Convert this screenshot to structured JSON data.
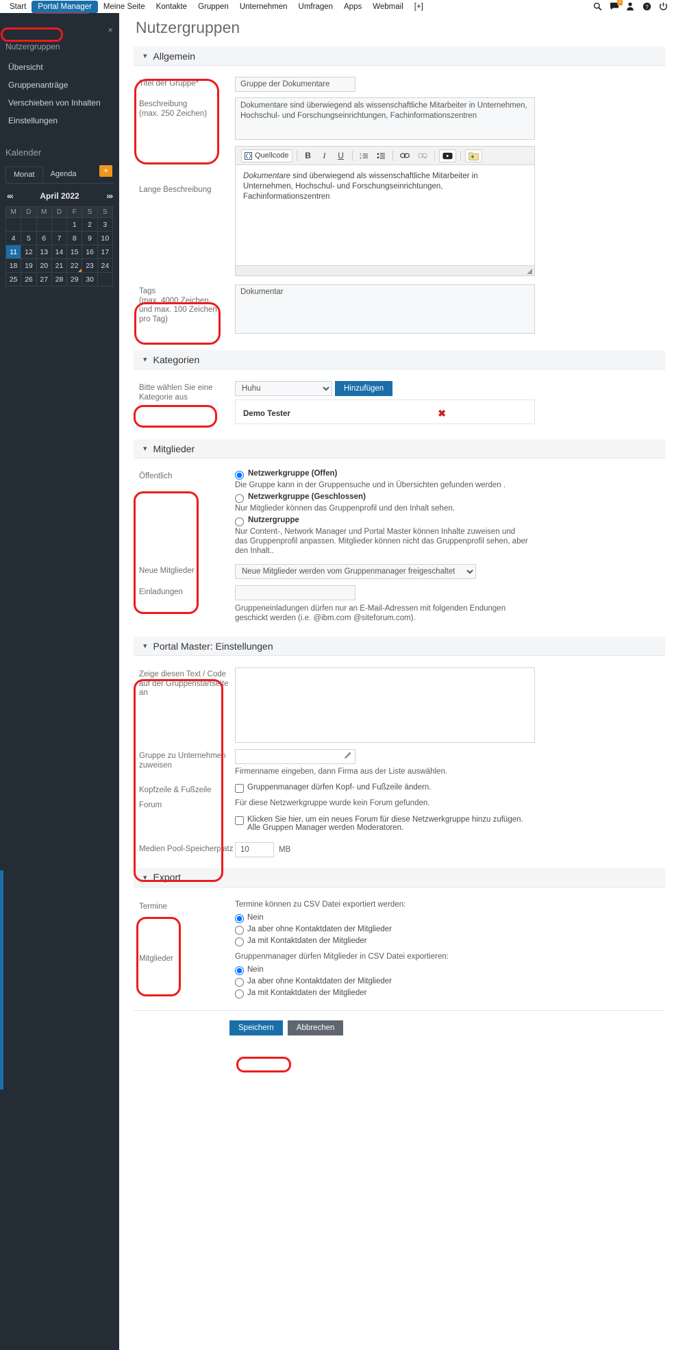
{
  "topnav": {
    "items": [
      {
        "label": "Start",
        "active": false
      },
      {
        "label": "Portal Manager",
        "active": true
      },
      {
        "label": "Meine Seite",
        "active": false
      },
      {
        "label": "Kontakte",
        "active": false
      },
      {
        "label": "Gruppen",
        "active": false
      },
      {
        "label": "Unternehmen",
        "active": false
      },
      {
        "label": "Umfragen",
        "active": false
      },
      {
        "label": "Apps",
        "active": false
      },
      {
        "label": "Webmail",
        "active": false
      },
      {
        "label": "[+]",
        "active": false
      }
    ],
    "icons": [
      "search-icon",
      "messages-icon",
      "user-icon",
      "help-icon",
      "power-icon"
    ],
    "message_badge": "2"
  },
  "sidebar": {
    "close_label": "×",
    "heading": "Nutzergruppen",
    "items": [
      {
        "label": "Übersicht"
      },
      {
        "label": "Gruppenanträge"
      },
      {
        "label": "Verschieben von Inhalten"
      },
      {
        "label": "Einstellungen"
      }
    ],
    "calendar": {
      "title": "Kalender",
      "tabs": [
        {
          "label": "Monat",
          "active": true
        },
        {
          "label": "Agenda",
          "active": false
        }
      ],
      "add_label": "+",
      "prev_label": "«‹",
      "next_label": "›»",
      "month": "April 2022",
      "weekdays": [
        "M",
        "D",
        "M",
        "D",
        "F",
        "S",
        "S"
      ],
      "weeks": [
        [
          "",
          "",
          "",
          "",
          "1",
          "2",
          "3"
        ],
        [
          "4",
          "5",
          "6",
          "7",
          "8",
          "9",
          "10"
        ],
        [
          "11",
          "12",
          "13",
          "14",
          "15",
          "16",
          "17"
        ],
        [
          "18",
          "19",
          "20",
          "21",
          "22",
          "23",
          "24"
        ],
        [
          "25",
          "26",
          "27",
          "28",
          "29",
          "30",
          ""
        ]
      ],
      "today": "11",
      "marked": "22"
    }
  },
  "page": {
    "title": "Nutzergruppen"
  },
  "sections": {
    "allgemein": {
      "title": "Allgemein",
      "labels": {
        "titel": "Titel der Gruppe*",
        "beschreibung": "Beschreibung\n(max. 250 Zeichen)",
        "lange_beschreibung": "Lange Beschreibung",
        "tags": "Tags\n(max. 4000 Zeichen\nund max. 100 Zeichen\npro Tag)"
      },
      "titel_value": "Gruppe der Dokumentare",
      "beschreibung_value": "Dokumentare sind überwiegend als wissenschaftliche Mitarbeiter in Unternehmen, Hochschul- und Forschungseinrichtungen, Fachinformationszentren",
      "editor": {
        "source_button": "Quellcode",
        "buttons": [
          "bold-icon",
          "italic-icon",
          "underline-icon",
          "ordered-list-icon",
          "bullet-list-icon",
          "link-icon",
          "unlink-icon",
          "video-icon",
          "add-media-icon"
        ],
        "bold": "B",
        "italic": "I",
        "underline": "U",
        "content_lead": "Dokumentare",
        "content_rest": " sind überwiegend als wissenschaftliche Mitarbeiter in Unternehmen, Hochschul- und Forschungseinrichtungen, Fachinformationszentren"
      },
      "tags_value": "Dokumentar"
    },
    "kategorien": {
      "title": "Kategorien",
      "label": "Bitte wählen Sie eine Kategorie aus",
      "selected_option": "Huhu",
      "options": [
        "Huhu"
      ],
      "add_button": "Hinzufügen",
      "rows": [
        {
          "name": "Demo Tester",
          "remove": "✖"
        }
      ]
    },
    "mitglieder": {
      "title": "Mitglieder",
      "labels": {
        "oeffentlich": "Öffentlich",
        "neue_mitglieder": "Neue Mitglieder",
        "einladungen": "Einladungen"
      },
      "options": [
        {
          "label": "Netzwerkgruppe (Offen)",
          "desc": "Die Gruppe kann in der Gruppensuche und in Übersichten gefunden werden .",
          "checked": true
        },
        {
          "label": "Netzwerkgruppe (Geschlossen)",
          "desc": "Nur Mitglieder können das Gruppenprofil und den Inhalt sehen.",
          "checked": false
        },
        {
          "label": "Nutzergruppe",
          "desc": "Nur Content-, Network Manager und Portal Master können Inhalte zuweisen und das Gruppenprofil anpassen. Mitglieder können nicht das Gruppenprofil sehen, aber den Inhalt..",
          "checked": false
        }
      ],
      "neue_mitglieder_selected": "Neue Mitglieder werden vom Gruppenmanager freigeschaltet",
      "einladungen_value": "",
      "einladungen_note": "Gruppeneinladungen dürfen nur an E-Mail-Adressen mit folgenden Endungen geschickt werden (i.e. @ibm.com @siteforum.com)."
    },
    "portalmaster": {
      "title": "Portal Master: Einstellungen",
      "labels": {
        "text_code": "Zeige diesen Text / Code auf der Gruppenstartseite an",
        "gruppe_zu": "Gruppe zu Unternehmen zuweisen",
        "kopfzeile": "Kopfzeile & Fußzeile",
        "forum": "Forum",
        "medienpool": "Medien Pool-Speicherplatz"
      },
      "text_code_value": "",
      "company_value": "",
      "company_hint": "Firmenname eingeben, dann Firma aus der Liste auswählen.",
      "kopfzeile_checkbox": "Gruppenmanager dürfen Kopf- und Fußzeile ändern.",
      "kopfzeile_checked": false,
      "forum_note": "Für diese Netzwerkgruppe wurde kein Forum gefunden.",
      "forum_checkbox": "Klicken Sie hier, um ein neues Forum für diese Netzwerkgruppe hinzu zufügen. Alle Gruppen Manager werden Moderatoren.",
      "forum_checked": false,
      "medienpool_value": "10",
      "medienpool_unit": "MB"
    },
    "export": {
      "title": "Export",
      "labels": {
        "termine": "Termine",
        "mitglieder": "Mitglieder"
      },
      "termine_note": "Termine können zu CSV Datei exportiert werden:",
      "termine_options": [
        {
          "label": "Nein",
          "checked": true
        },
        {
          "label": "Ja aber ohne Kontaktdaten der Mitglieder",
          "checked": false
        },
        {
          "label": "Ja mit Kontaktdaten der Mitglieder",
          "checked": false
        }
      ],
      "mitglieder_note": "Gruppenmanager dürfen Mitglieder in CSV Datei exportieren:",
      "mitglieder_options": [
        {
          "label": "Nein",
          "checked": true
        },
        {
          "label": "Ja aber ohne Kontaktdaten der Mitglieder",
          "checked": false
        },
        {
          "label": "Ja mit Kontaktdaten der Mitglieder",
          "checked": false
        }
      ]
    }
  },
  "footer": {
    "save_label": "Speichern",
    "cancel_label": "Abbrechen"
  },
  "colors": {
    "accent": "#1a6fa8",
    "sidebar_bg": "#242c36",
    "annotation_red": "#ee1b1b",
    "badge_orange": "#f0951e"
  }
}
